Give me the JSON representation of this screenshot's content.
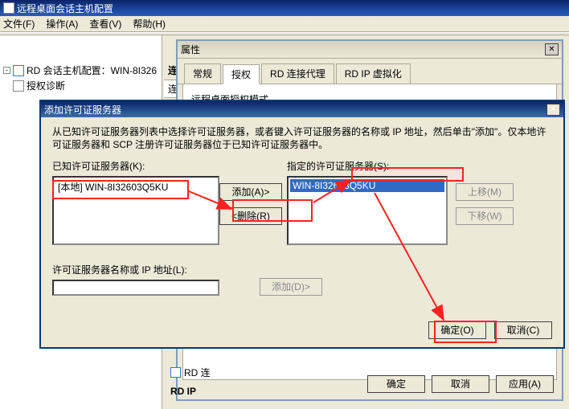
{
  "main_window": {
    "title": "远程桌面会话主机配置",
    "menu": {
      "file": "文件(F)",
      "action": "操作(A)",
      "view": "查看(V)",
      "help": "帮助(H)"
    }
  },
  "tree": {
    "item1": "RD 会话主机配置：WIN-8I326",
    "item2": "授权诊断",
    "expander": "-"
  },
  "conn": {
    "header": "连接",
    "colname": "连接名"
  },
  "properties": {
    "title": "属性",
    "tabs": {
      "general": "常规",
      "license": "授权",
      "broker": "RD 连接代理",
      "ip": "RD IP 虚拟化"
    },
    "heading": "远程桌面授权模式",
    "ok": "确定",
    "cancel": "取消",
    "apply": "应用(A)",
    "peek_rd": "RD 连",
    "peek_rdip": "RD IP"
  },
  "add_license": {
    "title": "添加许可证服务器",
    "instructions": "从已知许可证服务器列表中选择许可证服务器，或者键入许可证服务器的名称或 IP 地址，然后单击\"添加\"。仅本地许可证服务器和 SCP 注册许可证服务器位于已知许可证服务器中。",
    "known_label": "已知许可证服务器(K):",
    "specified_label": "指定的许可证服务器(S):",
    "ip_label": "许可证服务器名称或 IP 地址(L):",
    "known_item": "[本地]  WIN-8I32603Q5KU",
    "specified_item": "WIN-8I32603Q5KU",
    "buttons": {
      "add": "添加(A)>",
      "remove": "<删除(R)",
      "add2": "添加(D)>",
      "up": "上移(M)",
      "down": "下移(W)",
      "ok": "确定(O)",
      "cancel": "取消(C)"
    }
  }
}
